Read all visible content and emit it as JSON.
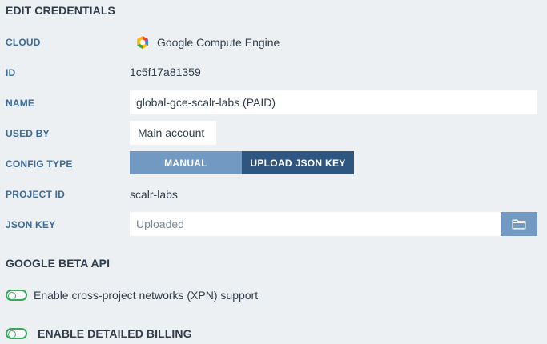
{
  "form": {
    "title": "EDIT CREDENTIALS",
    "labels": {
      "cloud": "CLOUD",
      "id": "ID",
      "name": "NAME",
      "used_by": "USED BY",
      "config_type": "CONFIG TYPE",
      "project_id": "PROJECT ID",
      "json_key": "JSON KEY"
    },
    "cloud_value": "Google Compute Engine",
    "cloud_icon": "google-cloud-hexagon-icon",
    "id_value": "1c5f17a81359",
    "name_value": "global-gce-scalr-labs (PAID)",
    "used_by_value": "Main account",
    "config_type_options": {
      "manual": "MANUAL",
      "upload": "UPLOAD JSON KEY"
    },
    "config_type_selected": "UPLOAD JSON KEY",
    "project_id_value": "scalr-labs",
    "json_key_placeholder": "Uploaded",
    "json_key_browse_icon": "folder-icon"
  },
  "beta_api": {
    "title": "GOOGLE BETA API",
    "xpn_label": "Enable cross-project networks (XPN) support",
    "xpn_enabled": false
  },
  "billing": {
    "label": "ENABLE DETAILED BILLING",
    "enabled": false
  },
  "colors": {
    "background": "#ecf0f3",
    "label_blue": "#3d6b9a",
    "segment_inactive": "#7199c1",
    "segment_active": "#2f5680",
    "toggle_green": "#35a85b"
  }
}
